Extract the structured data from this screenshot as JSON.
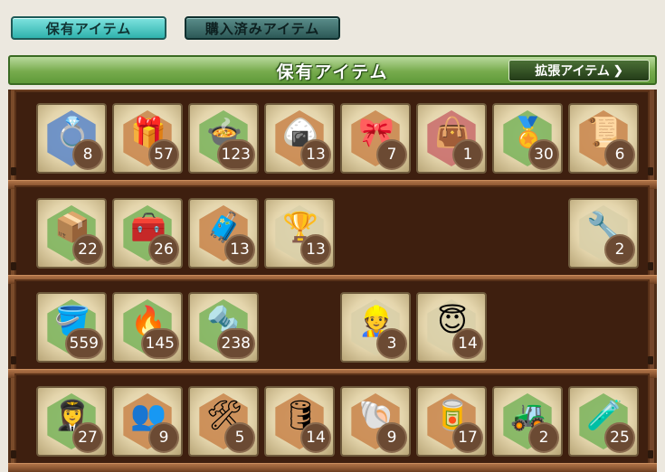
{
  "tabs": [
    {
      "label": "保有アイテム",
      "active": true
    },
    {
      "label": "購入済みアイテム",
      "active": false
    }
  ],
  "banner": {
    "title": "保有アイテム",
    "extended_button": "拡張アイテム",
    "extended_icon": "chevron-right-icon"
  },
  "shelves": [
    {
      "items": [
        {
          "name": "letter-ring-icon",
          "glyph": "💍",
          "count": "8",
          "hex": "#5a86c8"
        },
        {
          "name": "jewel-box-icon",
          "glyph": "🎁",
          "count": "57",
          "hex": "#c8844a"
        },
        {
          "name": "silver-pot-icon",
          "glyph": "🍲",
          "count": "123",
          "hex": "#79b35a"
        },
        {
          "name": "food-basket-icon",
          "glyph": "🍙",
          "count": "13",
          "hex": "#c8844a"
        },
        {
          "name": "present-box-icon",
          "glyph": "🎀",
          "count": "7",
          "hex": "#c8844a"
        },
        {
          "name": "red-sack-icon",
          "glyph": "👜",
          "count": "1",
          "hex": "#c86a6a"
        },
        {
          "name": "medal-icon",
          "glyph": "🏅",
          "count": "30",
          "hex": "#79b35a"
        },
        {
          "name": "blueprint-icon",
          "glyph": "📜",
          "count": "6",
          "hex": "#c8844a"
        }
      ]
    },
    {
      "items": [
        {
          "name": "wooden-chest-icon",
          "glyph": "📦",
          "count": "22",
          "hex": "#79b35a"
        },
        {
          "name": "purple-chest-icon",
          "glyph": "🧰",
          "count": "26",
          "hex": "#79b35a"
        },
        {
          "name": "red-chest-icon",
          "glyph": "🧳",
          "count": "13",
          "hex": "#c8844a"
        },
        {
          "name": "goblet-icon",
          "glyph": "🏆",
          "count": "13",
          "hex": "#d8cfa8"
        },
        {
          "name": "",
          "glyph": "",
          "count": "",
          "hex": ""
        },
        {
          "name": "",
          "glyph": "",
          "count": "",
          "hex": ""
        },
        {
          "name": "",
          "glyph": "",
          "count": "",
          "hex": ""
        },
        {
          "name": "repair-girl-icon",
          "glyph": "🔧",
          "count": "2",
          "hex": "#d8cfa8"
        }
      ]
    },
    {
      "items": [
        {
          "name": "bucket-icon",
          "glyph": "🪣",
          "count": "559",
          "hex": "#79b35a"
        },
        {
          "name": "burner-icon",
          "glyph": "🔥",
          "count": "145",
          "hex": "#79b35a"
        },
        {
          "name": "screw-icon",
          "glyph": "🔩",
          "count": "238",
          "hex": "#79b35a"
        },
        {
          "name": "",
          "glyph": "",
          "count": "",
          "hex": ""
        },
        {
          "name": "fairy-hat-icon",
          "glyph": "👷",
          "count": "3",
          "hex": "#d8cfa8"
        },
        {
          "name": "fairy-halo-icon",
          "glyph": "😇",
          "count": "14",
          "hex": "#d8cfa8"
        },
        {
          "name": "",
          "glyph": "",
          "count": "",
          "hex": ""
        },
        {
          "name": "",
          "glyph": "",
          "count": "",
          "hex": ""
        }
      ]
    },
    {
      "items": [
        {
          "name": "pilot-fairy-icon",
          "glyph": "👩‍✈️",
          "count": "27",
          "hex": "#79b35a"
        },
        {
          "name": "crew-fairies-icon",
          "glyph": "👥",
          "count": "9",
          "hex": "#c8844a"
        },
        {
          "name": "tools-icon",
          "glyph": "🛠",
          "count": "5",
          "hex": "#c8844a"
        },
        {
          "name": "barrel-icon",
          "glyph": "🛢",
          "count": "14",
          "hex": "#c8844a"
        },
        {
          "name": "shell-icon",
          "glyph": "🐚",
          "count": "9",
          "hex": "#c8844a"
        },
        {
          "name": "supply-can-icon",
          "glyph": "🥫",
          "count": "17",
          "hex": "#c8844a"
        },
        {
          "name": "bulldozer-icon",
          "glyph": "🚜",
          "count": "2",
          "hex": "#79b35a"
        },
        {
          "name": "ammo-icon",
          "glyph": "🧪",
          "count": "25",
          "hex": "#79b35a"
        }
      ]
    }
  ]
}
